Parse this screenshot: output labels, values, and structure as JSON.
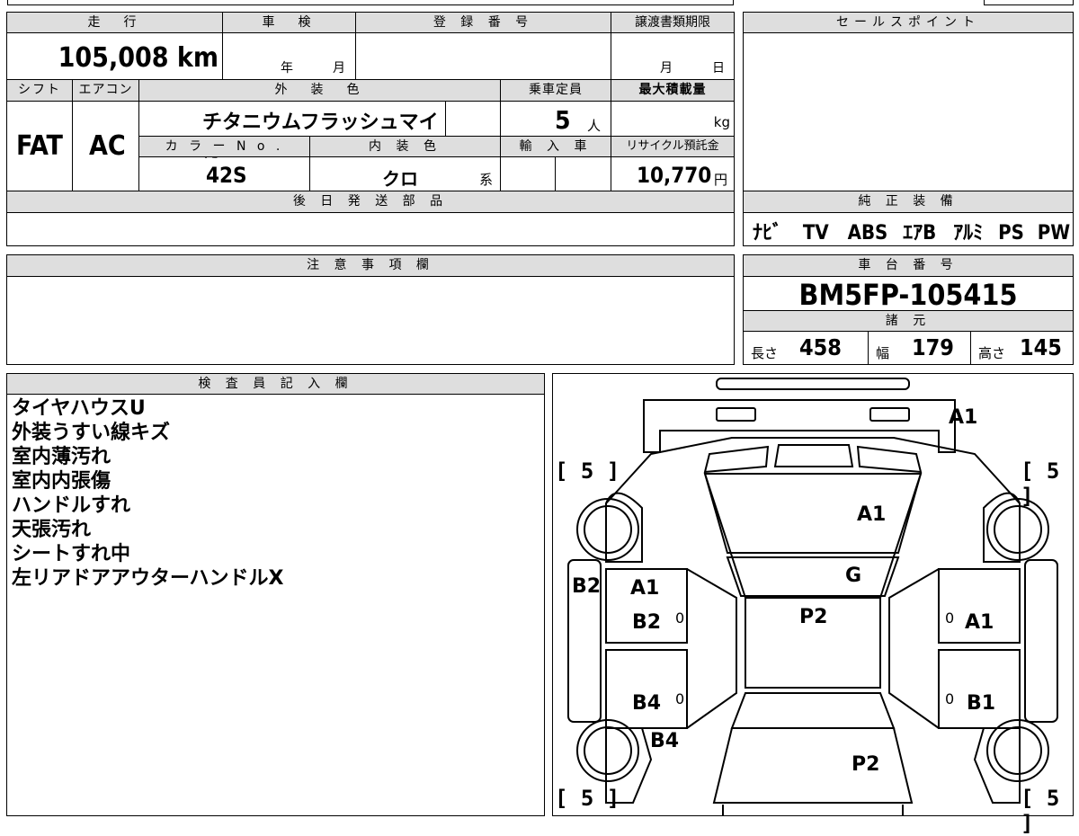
{
  "top": {
    "mileage_hdr": "走　行",
    "mileage_val": "105,008 km",
    "shaken_hdr": "車　検",
    "shaken_year": "年",
    "shaken_month": "月",
    "regno_hdr": "登 録 番 号",
    "transfer_hdr": "譲渡書類期限",
    "transfer_month": "月",
    "transfer_day": "日",
    "sales_hdr": "セールスポイント"
  },
  "row2": {
    "shift_hdr": "シフト",
    "ac_hdr": "エアコン",
    "color_hdr": "外　装　色",
    "capacity_hdr": "乗車定員",
    "maxload_hdr": "最大積載量",
    "shift_val": "FAT",
    "ac_val": "AC",
    "color_val": "チタニウムフラッシュマイカ",
    "capacity_val": "5",
    "capacity_unit": "人",
    "maxload_unit": "kg",
    "colorno_hdr": "カ ラ ー N o .",
    "interior_hdr": "内 装 色",
    "import_hdr": "輸 入 車",
    "recycle_hdr": "リサイクル預託金",
    "colorno_val": "42S",
    "interior_val": "クロ",
    "interior_suffix": "系",
    "recycle_val": "10,770",
    "recycle_unit": "円"
  },
  "parts": {
    "hdr": "後 日 発 送 部 品"
  },
  "equipment": {
    "hdr": "純 正 装 備",
    "items": [
      "ﾅﾋﾞ",
      "TV",
      "ABS",
      "ｴｱB",
      "ｱﾙﾐ",
      "PS",
      "PW"
    ]
  },
  "notice": {
    "hdr": "注 意 事 項 欄"
  },
  "chassis": {
    "hdr": "車 台 番 号",
    "val": "BM5FP-105415",
    "spec_hdr": "諸 元",
    "length_lbl": "長さ",
    "length_val": "458",
    "width_lbl": "幅",
    "width_val": "179",
    "height_lbl": "高さ",
    "height_val": "145"
  },
  "inspector": {
    "hdr": "検 査 員 記 入 欄",
    "notes": [
      "タイヤハウスU",
      "外装うすい線キズ",
      "室内薄汚れ",
      "室内内張傷",
      "ハンドルすれ",
      "天張汚れ",
      "シートすれ中",
      "左リアドアアウターハンドルX"
    ]
  },
  "diagram": {
    "tires": [
      "[ 5 ]",
      "[ 5 ]",
      "[ 5 ]",
      "[ 5 ]"
    ],
    "marks": {
      "front_bumper": "A1",
      "hood": "A1",
      "windshield": "G",
      "roof": "P2",
      "left_fender": "B2",
      "left_front_door_1": "A1",
      "left_front_door_2": "B2",
      "left_rear_door": "B4",
      "left_rear_fender": "B4",
      "right_front_door": "A1",
      "right_rear_door": "B1",
      "trunk": "P2",
      "zero1": "0",
      "zero2": "0",
      "zero3": "0",
      "zero4": "0"
    }
  }
}
